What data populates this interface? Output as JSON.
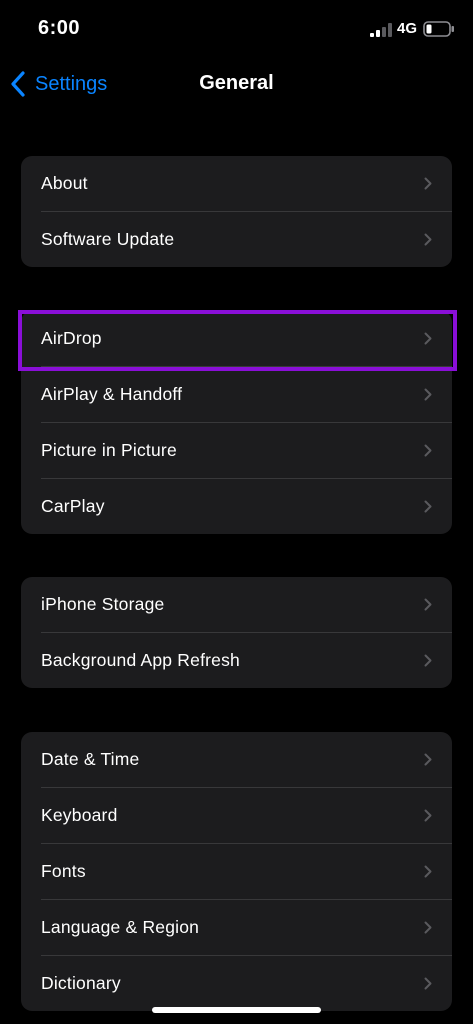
{
  "status_bar": {
    "time": "6:00",
    "network": "4G",
    "signal_icon": "cellular-signal-icon",
    "battery_icon": "battery-low-icon"
  },
  "nav": {
    "back_label": "Settings",
    "back_icon": "chevron-left-icon",
    "title": "General"
  },
  "colors": {
    "background": "#000000",
    "group_background": "#1c1c1e",
    "accent": "#0a84ff",
    "highlight": "#8a0fd8",
    "separator": "#38383a",
    "chevron": "#5a5a5e"
  },
  "groups": [
    {
      "items": [
        {
          "label": "About"
        },
        {
          "label": "Software Update"
        }
      ]
    },
    {
      "items": [
        {
          "label": "AirDrop"
        },
        {
          "label": "AirPlay & Handoff"
        },
        {
          "label": "Picture in Picture"
        },
        {
          "label": "CarPlay"
        }
      ]
    },
    {
      "items": [
        {
          "label": "iPhone Storage"
        },
        {
          "label": "Background App Refresh"
        }
      ]
    },
    {
      "items": [
        {
          "label": "Date & Time"
        },
        {
          "label": "Keyboard"
        },
        {
          "label": "Fonts"
        },
        {
          "label": "Language & Region"
        },
        {
          "label": "Dictionary"
        }
      ]
    }
  ],
  "highlighted_item": "AirDrop"
}
